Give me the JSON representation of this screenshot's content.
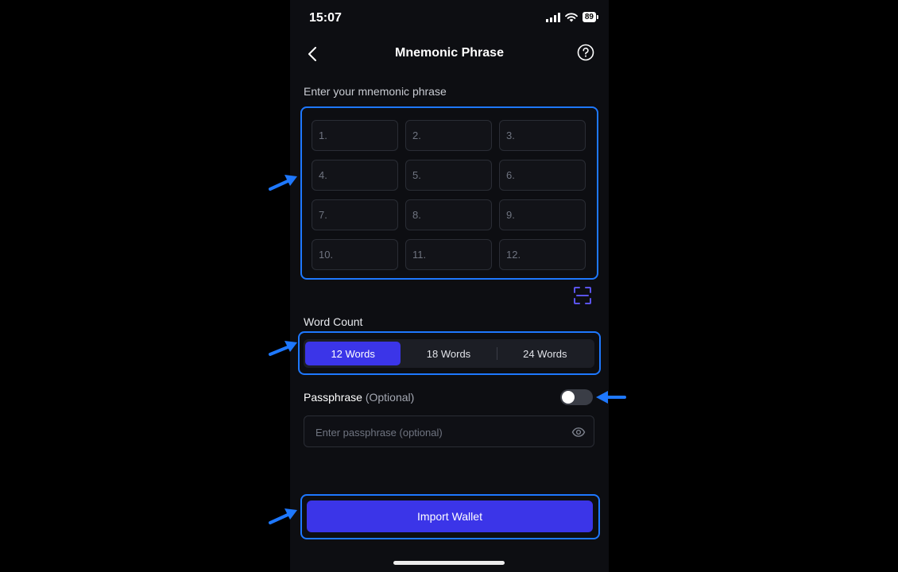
{
  "status": {
    "time": "15:07",
    "battery": "89"
  },
  "header": {
    "title": "Mnemonic Phrase"
  },
  "mnemonic": {
    "label": "Enter your mnemonic phrase",
    "cells": [
      "1.",
      "2.",
      "3.",
      "4.",
      "5.",
      "6.",
      "7.",
      "8.",
      "9.",
      "10.",
      "11.",
      "12."
    ]
  },
  "word_count": {
    "label": "Word Count",
    "options": [
      "12 Words",
      "18 Words",
      "24 Words"
    ],
    "selected": "12 Words"
  },
  "passphrase": {
    "label": "Passphrase",
    "optional": "(Optional)",
    "placeholder": "Enter passphrase (optional)",
    "enabled": false
  },
  "import_button": "Import Wallet",
  "colors": {
    "accent": "#3b35e8",
    "highlight": "#1e78ff",
    "background": "#0d0e12"
  }
}
